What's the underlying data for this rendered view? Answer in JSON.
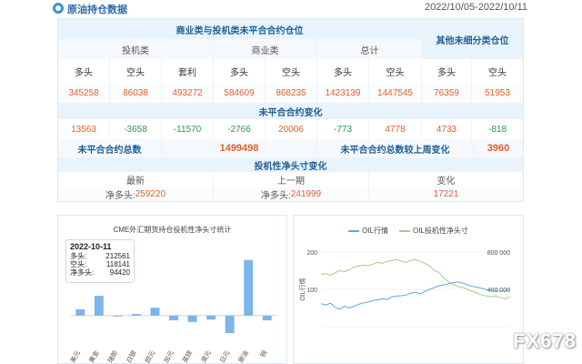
{
  "header": {
    "title": "原油持仓数据",
    "date_range": "2022/10/05-2022/10/11"
  },
  "table": {
    "group_header": "商业类与投机类未平合合约仓位",
    "other_header": "其他未细分类仓位",
    "sub_headers": [
      "投机类",
      "商业类",
      "总计"
    ],
    "col_headers": [
      "多头",
      "空头",
      "套利",
      "多头",
      "空头",
      "多头",
      "空头",
      "多头",
      "空头"
    ],
    "values": [
      "345258",
      "86038",
      "493272",
      "584609",
      "868235",
      "1423139",
      "1447545",
      "76359",
      "51953"
    ],
    "change_header": "未平合合约变化",
    "changes": [
      "13563",
      "-3658",
      "-11570",
      "-2766",
      "20006",
      "-773",
      "4778",
      "4733",
      "-818"
    ],
    "total_label": "未平合合约总数",
    "total_value": "1499498",
    "total_change_label": "未平合合约总数较上周变化",
    "total_change_value": "3960",
    "net_header": "投机性净头寸变化",
    "net_cols": [
      "最新",
      "上一期",
      "变化"
    ],
    "net_latest_label": "净多头:",
    "net_latest_value": "259220",
    "net_prev_label": "净多头:",
    "net_prev_value": "241999",
    "net_change_value": "17221"
  },
  "colors": {
    "accent": "#2c6aa8",
    "orange": "#e0612e",
    "green": "#2e9a4a",
    "bar": "#7cb5ec",
    "line_oil": "#5aa9e6",
    "line_net": "#9fd08f"
  },
  "chart_left": {
    "tooltip": {
      "date": "2022-10-11",
      "rows": [
        {
          "label": "多头:",
          "value": "212561"
        },
        {
          "label": "空头:",
          "value": "118141"
        },
        {
          "label": "净多头:",
          "value": "94420"
        }
      ]
    }
  },
  "chart_right": {
    "legend": [
      "OIL行情",
      "OIL投机性净头寸"
    ]
  },
  "chart_data": [
    {
      "type": "bar",
      "title": "CME外汇期货持仓投机性净头寸统计",
      "categories": [
        "美元",
        "黄金",
        "瑞郎",
        "白银",
        "欧元",
        "加元",
        "英镑",
        "澳元",
        "日元",
        "原油",
        "铜"
      ],
      "values": [
        8,
        25,
        0,
        2,
        10,
        -6,
        -8,
        -5,
        -22,
        70,
        -6
      ],
      "ylim": [
        -30,
        80
      ]
    },
    {
      "type": "line",
      "title": "",
      "left_axis_label": "OIL行情",
      "left_ticks": [
        "200",
        "100"
      ],
      "right_ticks": [
        "800 000",
        "400 000"
      ],
      "ylim_left": [
        0,
        200
      ],
      "ylim_right": [
        0,
        800000
      ],
      "series": [
        {
          "name": "OIL行情",
          "values": [
            62,
            58,
            63,
            52,
            47,
            55,
            50,
            55,
            60,
            64,
            66,
            70,
            72,
            75,
            73,
            80,
            82,
            83,
            85,
            90,
            92,
            88,
            95,
            100,
            105,
            110,
            112,
            115,
            118,
            120,
            117,
            112,
            108,
            106,
            103,
            99,
            98,
            96,
            95,
            96,
            100
          ]
        },
        {
          "name": "OIL投机性净头寸",
          "values": [
            560000,
            570000,
            550000,
            580000,
            600000,
            590000,
            610000,
            640000,
            650000,
            660000,
            655000,
            670000,
            690000,
            680000,
            700000,
            710000,
            720000,
            700000,
            690000,
            710000,
            720000,
            700000,
            680000,
            650000,
            600000,
            580000,
            520000,
            480000,
            450000,
            430000,
            420000,
            400000,
            380000,
            360000,
            340000,
            330000,
            320000,
            330000,
            310000,
            300000,
            320000
          ]
        }
      ]
    }
  ]
}
